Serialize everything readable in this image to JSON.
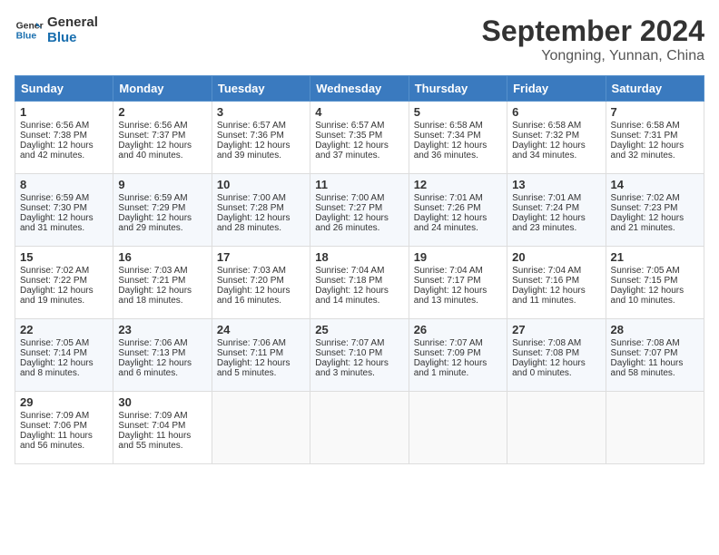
{
  "header": {
    "logo_general": "General",
    "logo_blue": "Blue",
    "month": "September 2024",
    "location": "Yongning, Yunnan, China"
  },
  "weekdays": [
    "Sunday",
    "Monday",
    "Tuesday",
    "Wednesday",
    "Thursday",
    "Friday",
    "Saturday"
  ],
  "weeks": [
    [
      {
        "day": "1",
        "lines": [
          "Sunrise: 6:56 AM",
          "Sunset: 7:38 PM",
          "Daylight: 12 hours",
          "and 42 minutes."
        ]
      },
      {
        "day": "2",
        "lines": [
          "Sunrise: 6:56 AM",
          "Sunset: 7:37 PM",
          "Daylight: 12 hours",
          "and 40 minutes."
        ]
      },
      {
        "day": "3",
        "lines": [
          "Sunrise: 6:57 AM",
          "Sunset: 7:36 PM",
          "Daylight: 12 hours",
          "and 39 minutes."
        ]
      },
      {
        "day": "4",
        "lines": [
          "Sunrise: 6:57 AM",
          "Sunset: 7:35 PM",
          "Daylight: 12 hours",
          "and 37 minutes."
        ]
      },
      {
        "day": "5",
        "lines": [
          "Sunrise: 6:58 AM",
          "Sunset: 7:34 PM",
          "Daylight: 12 hours",
          "and 36 minutes."
        ]
      },
      {
        "day": "6",
        "lines": [
          "Sunrise: 6:58 AM",
          "Sunset: 7:32 PM",
          "Daylight: 12 hours",
          "and 34 minutes."
        ]
      },
      {
        "day": "7",
        "lines": [
          "Sunrise: 6:58 AM",
          "Sunset: 7:31 PM",
          "Daylight: 12 hours",
          "and 32 minutes."
        ]
      }
    ],
    [
      {
        "day": "8",
        "lines": [
          "Sunrise: 6:59 AM",
          "Sunset: 7:30 PM",
          "Daylight: 12 hours",
          "and 31 minutes."
        ]
      },
      {
        "day": "9",
        "lines": [
          "Sunrise: 6:59 AM",
          "Sunset: 7:29 PM",
          "Daylight: 12 hours",
          "and 29 minutes."
        ]
      },
      {
        "day": "10",
        "lines": [
          "Sunrise: 7:00 AM",
          "Sunset: 7:28 PM",
          "Daylight: 12 hours",
          "and 28 minutes."
        ]
      },
      {
        "day": "11",
        "lines": [
          "Sunrise: 7:00 AM",
          "Sunset: 7:27 PM",
          "Daylight: 12 hours",
          "and 26 minutes."
        ]
      },
      {
        "day": "12",
        "lines": [
          "Sunrise: 7:01 AM",
          "Sunset: 7:26 PM",
          "Daylight: 12 hours",
          "and 24 minutes."
        ]
      },
      {
        "day": "13",
        "lines": [
          "Sunrise: 7:01 AM",
          "Sunset: 7:24 PM",
          "Daylight: 12 hours",
          "and 23 minutes."
        ]
      },
      {
        "day": "14",
        "lines": [
          "Sunrise: 7:02 AM",
          "Sunset: 7:23 PM",
          "Daylight: 12 hours",
          "and 21 minutes."
        ]
      }
    ],
    [
      {
        "day": "15",
        "lines": [
          "Sunrise: 7:02 AM",
          "Sunset: 7:22 PM",
          "Daylight: 12 hours",
          "and 19 minutes."
        ]
      },
      {
        "day": "16",
        "lines": [
          "Sunrise: 7:03 AM",
          "Sunset: 7:21 PM",
          "Daylight: 12 hours",
          "and 18 minutes."
        ]
      },
      {
        "day": "17",
        "lines": [
          "Sunrise: 7:03 AM",
          "Sunset: 7:20 PM",
          "Daylight: 12 hours",
          "and 16 minutes."
        ]
      },
      {
        "day": "18",
        "lines": [
          "Sunrise: 7:04 AM",
          "Sunset: 7:18 PM",
          "Daylight: 12 hours",
          "and 14 minutes."
        ]
      },
      {
        "day": "19",
        "lines": [
          "Sunrise: 7:04 AM",
          "Sunset: 7:17 PM",
          "Daylight: 12 hours",
          "and 13 minutes."
        ]
      },
      {
        "day": "20",
        "lines": [
          "Sunrise: 7:04 AM",
          "Sunset: 7:16 PM",
          "Daylight: 12 hours",
          "and 11 minutes."
        ]
      },
      {
        "day": "21",
        "lines": [
          "Sunrise: 7:05 AM",
          "Sunset: 7:15 PM",
          "Daylight: 12 hours",
          "and 10 minutes."
        ]
      }
    ],
    [
      {
        "day": "22",
        "lines": [
          "Sunrise: 7:05 AM",
          "Sunset: 7:14 PM",
          "Daylight: 12 hours",
          "and 8 minutes."
        ]
      },
      {
        "day": "23",
        "lines": [
          "Sunrise: 7:06 AM",
          "Sunset: 7:13 PM",
          "Daylight: 12 hours",
          "and 6 minutes."
        ]
      },
      {
        "day": "24",
        "lines": [
          "Sunrise: 7:06 AM",
          "Sunset: 7:11 PM",
          "Daylight: 12 hours",
          "and 5 minutes."
        ]
      },
      {
        "day": "25",
        "lines": [
          "Sunrise: 7:07 AM",
          "Sunset: 7:10 PM",
          "Daylight: 12 hours",
          "and 3 minutes."
        ]
      },
      {
        "day": "26",
        "lines": [
          "Sunrise: 7:07 AM",
          "Sunset: 7:09 PM",
          "Daylight: 12 hours",
          "and 1 minute."
        ]
      },
      {
        "day": "27",
        "lines": [
          "Sunrise: 7:08 AM",
          "Sunset: 7:08 PM",
          "Daylight: 12 hours",
          "and 0 minutes."
        ]
      },
      {
        "day": "28",
        "lines": [
          "Sunrise: 7:08 AM",
          "Sunset: 7:07 PM",
          "Daylight: 11 hours",
          "and 58 minutes."
        ]
      }
    ],
    [
      {
        "day": "29",
        "lines": [
          "Sunrise: 7:09 AM",
          "Sunset: 7:06 PM",
          "Daylight: 11 hours",
          "and 56 minutes."
        ]
      },
      {
        "day": "30",
        "lines": [
          "Sunrise: 7:09 AM",
          "Sunset: 7:04 PM",
          "Daylight: 11 hours",
          "and 55 minutes."
        ]
      },
      {
        "day": "",
        "lines": []
      },
      {
        "day": "",
        "lines": []
      },
      {
        "day": "",
        "lines": []
      },
      {
        "day": "",
        "lines": []
      },
      {
        "day": "",
        "lines": []
      }
    ]
  ]
}
